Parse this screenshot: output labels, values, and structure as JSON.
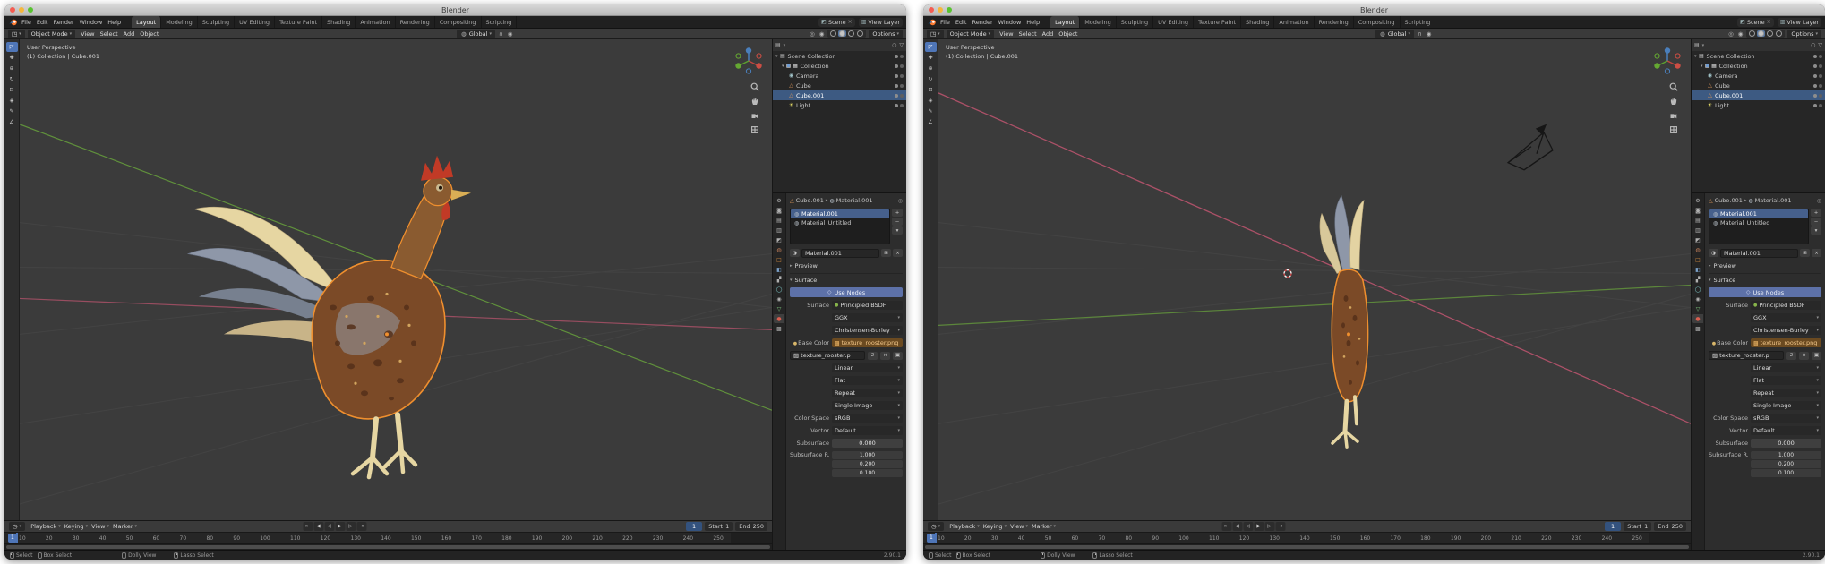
{
  "window": {
    "title": "Blender"
  },
  "topbar": {
    "menus": [
      "File",
      "Edit",
      "Render",
      "Window",
      "Help"
    ],
    "workspaces": [
      "Layout",
      "Modeling",
      "Sculpting",
      "UV Editing",
      "Texture Paint",
      "Shading",
      "Animation",
      "Rendering",
      "Compositing",
      "Scripting"
    ],
    "active_workspace": "Layout",
    "scene": "Scene",
    "view_layer": "View Layer"
  },
  "tool_header": {
    "mode": "Object Mode",
    "menus": [
      "View",
      "Select",
      "Add",
      "Object"
    ],
    "transform_orientation": "Global",
    "options": "Options"
  },
  "viewport": {
    "overlay_line1": "User Perspective",
    "overlay_line2": "(1) Collection | Cube.001"
  },
  "toolbar_tools": [
    {
      "name": "select-box",
      "glyph": "◸"
    },
    {
      "name": "cursor",
      "glyph": "✚"
    },
    {
      "name": "move",
      "glyph": "⊕"
    },
    {
      "name": "rotate",
      "glyph": "↻"
    },
    {
      "name": "scale",
      "glyph": "⊡"
    },
    {
      "name": "transform",
      "glyph": "◈"
    },
    {
      "name": "annotate",
      "glyph": "✎"
    },
    {
      "name": "measure",
      "glyph": "∠"
    }
  ],
  "outliner": {
    "items": [
      {
        "label": "Scene Collection",
        "icon": "scene-collection",
        "indent": 0,
        "selected": false,
        "caret": true,
        "checkbox": false
      },
      {
        "label": "Collection",
        "icon": "collection",
        "indent": 1,
        "selected": false,
        "caret": true,
        "checkbox": true
      },
      {
        "label": "Camera",
        "icon": "camera",
        "indent": 2,
        "selected": false,
        "caret": false,
        "checkbox": false
      },
      {
        "label": "Cube",
        "icon": "mesh",
        "indent": 2,
        "selected": false,
        "caret": false,
        "checkbox": false
      },
      {
        "label": "Cube.001",
        "icon": "mesh",
        "indent": 2,
        "selected": true,
        "caret": false,
        "checkbox": false
      },
      {
        "label": "Light",
        "icon": "light",
        "indent": 2,
        "selected": false,
        "caret": false,
        "checkbox": false
      }
    ]
  },
  "properties": {
    "tabs": [
      {
        "name": "tool",
        "glyph": "⚙",
        "color": "#b0b0b0",
        "active": false
      },
      {
        "name": "render",
        "glyph": "◙",
        "color": "#b0b0b0",
        "active": false
      },
      {
        "name": "output",
        "glyph": "▤",
        "color": "#b0b0b0",
        "active": false
      },
      {
        "name": "view-layer",
        "glyph": "▥",
        "color": "#b0b0b0",
        "active": false
      },
      {
        "name": "scene",
        "glyph": "◩",
        "color": "#b0b0b0",
        "active": false
      },
      {
        "name": "world",
        "glyph": "◍",
        "color": "#c47e5a",
        "active": false
      },
      {
        "name": "object",
        "glyph": "□",
        "color": "#d98e3f",
        "active": false
      },
      {
        "name": "modifiers",
        "glyph": "◧",
        "color": "#7aa0c8",
        "active": false
      },
      {
        "name": "particles",
        "glyph": "▞",
        "color": "#b0b0b0",
        "active": false
      },
      {
        "name": "physics",
        "glyph": "◯",
        "color": "#7ec8c8",
        "active": false
      },
      {
        "name": "constraints",
        "glyph": "◉",
        "color": "#b0b0b0",
        "active": false
      },
      {
        "name": "object-data",
        "glyph": "▽",
        "color": "#7ec87e",
        "active": false
      },
      {
        "name": "material",
        "glyph": "●",
        "color": "#d85f50",
        "active": true
      },
      {
        "name": "texture",
        "glyph": "▩",
        "color": "#b0b0b0",
        "active": false
      }
    ],
    "breadcrumb": {
      "object": "Cube.001",
      "material": "Material.001"
    },
    "slots": [
      {
        "name": "Material.001",
        "selected": true
      },
      {
        "name": "Material_Untitled",
        "selected": false
      }
    ],
    "name_field": "Material.001",
    "panels": {
      "preview": "Preview",
      "surface": "Surface"
    },
    "use_nodes": "Use Nodes",
    "rows": {
      "surface_label": "Surface",
      "surface_value": "Principled BSDF",
      "distribution": "GGX",
      "subsurface_method": "Christensen-Burley",
      "base_color_label": "Base Color",
      "base_color_value": "texture_rooster.png",
      "image_name": "texture_rooster.p",
      "image_users": "2",
      "interpolation": "Linear",
      "projection": "Flat",
      "extension": "Repeat",
      "source": "Single Image",
      "color_space_label": "Color Space",
      "color_space_value": "sRGB",
      "vector_label": "Vector",
      "vector_value": "Default",
      "subsurface_label": "Subsurface",
      "subsurface_value": "0.000",
      "subsurface_radius_label": "Subsurface R...",
      "subsurface_radius_values": [
        "1.000",
        "0.200",
        "0.100"
      ]
    }
  },
  "timeline": {
    "menus": [
      "Playback",
      "Keying",
      "View",
      "Marker"
    ],
    "playback_buttons": [
      {
        "name": "jump-to-start",
        "glyph": "⇤"
      },
      {
        "name": "previous-keyframe",
        "glyph": "◀"
      },
      {
        "name": "play-reverse",
        "glyph": "◁"
      },
      {
        "name": "play",
        "glyph": "▶"
      },
      {
        "name": "next-keyframe",
        "glyph": "▷"
      },
      {
        "name": "jump-to-end",
        "glyph": "⇥"
      }
    ],
    "current_frame": "1",
    "start_label": "Start",
    "start_value": "1",
    "end_label": "End",
    "end_value": "250",
    "ticks": [
      "10",
      "20",
      "30",
      "40",
      "50",
      "60",
      "70",
      "80",
      "90",
      "100",
      "110",
      "120",
      "130",
      "140",
      "150",
      "160",
      "170",
      "180",
      "190",
      "200",
      "210",
      "220",
      "230",
      "240",
      "250"
    ]
  },
  "status_bar": {
    "select": "Select",
    "box_select": "Box Select",
    "dolly": "Dolly View",
    "lasso": "Lasso Select",
    "version": "2.90.1"
  },
  "icon_glyphs": {
    "caret_down": "▾",
    "caret_right": "▸",
    "cross": "×",
    "plus": "+",
    "minus": "−",
    "scene-collection": "▤",
    "collection": "▦",
    "camera": "◉",
    "mesh": "△",
    "light": "☀",
    "material": "◍",
    "scene": "◩",
    "view_layer": "▥",
    "pin": "◎",
    "nodes": "◇",
    "shader_dot": "●",
    "socket_dot": "●",
    "texture": "▩",
    "image": "▨",
    "folder": "▣",
    "browse": "◑",
    "duplicate": "⊞",
    "editor_3d": "◳",
    "editor_outliner": "▤",
    "editor_timeline": "◷",
    "search": "○",
    "funnel": "▽",
    "globe": "◍",
    "magnet": "∩",
    "proportional": "◉",
    "overlay": "◎"
  },
  "colors": {
    "accent_blue": "#4f76b8",
    "selection_orange": "#ef8f2e",
    "use_nodes_blue": "#5d71a8",
    "axis_green": "#67a03c",
    "axis_red": "#c05570"
  }
}
